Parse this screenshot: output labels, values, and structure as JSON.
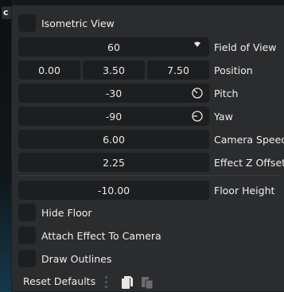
{
  "backdrop": {
    "corner_glyph": "c"
  },
  "isometric": {
    "label": "Isometric View",
    "checked": false
  },
  "fov": {
    "value": "60",
    "label": "Field of View",
    "icon": "fov-indicator-icon"
  },
  "position": {
    "x": "0.00",
    "y": "3.50",
    "z": "7.50",
    "label": "Position"
  },
  "pitch": {
    "value": "-30",
    "label": "Pitch",
    "icon": "pitch-dial-icon"
  },
  "yaw": {
    "value": "-90",
    "label": "Yaw",
    "icon": "yaw-dial-icon"
  },
  "camera_speed": {
    "value": "6.00",
    "label": "Camera Speed"
  },
  "effect_z_offset": {
    "value": "2.25",
    "label": "Effect Z Offset"
  },
  "floor_height": {
    "value": "-10.00",
    "label": "Floor Height"
  },
  "hide_floor": {
    "label": "Hide Floor",
    "checked": false
  },
  "attach_effect": {
    "label": "Attach Effect To Camera",
    "checked": false
  },
  "draw_outlines": {
    "label": "Draw Outlines",
    "checked": false
  },
  "footer": {
    "reset_label": "Reset Defaults",
    "copy_icon": "copy-icon",
    "paste_icon": "paste-icon"
  },
  "colors": {
    "panel": "#2b2c2e",
    "field": "#1d1e20",
    "text": "#e9e9e9"
  }
}
